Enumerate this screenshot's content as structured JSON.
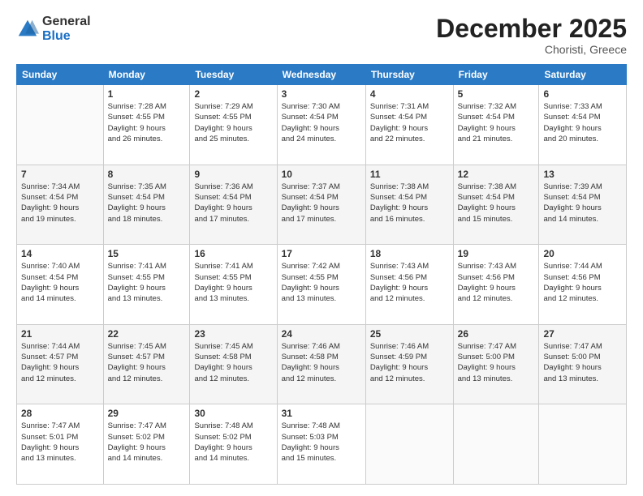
{
  "logo": {
    "general": "General",
    "blue": "Blue"
  },
  "header": {
    "month": "December 2025",
    "location": "Choristi, Greece"
  },
  "days_of_week": [
    "Sunday",
    "Monday",
    "Tuesday",
    "Wednesday",
    "Thursday",
    "Friday",
    "Saturday"
  ],
  "weeks": [
    [
      {
        "day": "",
        "info": ""
      },
      {
        "day": "1",
        "info": "Sunrise: 7:28 AM\nSunset: 4:55 PM\nDaylight: 9 hours\nand 26 minutes."
      },
      {
        "day": "2",
        "info": "Sunrise: 7:29 AM\nSunset: 4:55 PM\nDaylight: 9 hours\nand 25 minutes."
      },
      {
        "day": "3",
        "info": "Sunrise: 7:30 AM\nSunset: 4:54 PM\nDaylight: 9 hours\nand 24 minutes."
      },
      {
        "day": "4",
        "info": "Sunrise: 7:31 AM\nSunset: 4:54 PM\nDaylight: 9 hours\nand 22 minutes."
      },
      {
        "day": "5",
        "info": "Sunrise: 7:32 AM\nSunset: 4:54 PM\nDaylight: 9 hours\nand 21 minutes."
      },
      {
        "day": "6",
        "info": "Sunrise: 7:33 AM\nSunset: 4:54 PM\nDaylight: 9 hours\nand 20 minutes."
      }
    ],
    [
      {
        "day": "7",
        "info": "Sunrise: 7:34 AM\nSunset: 4:54 PM\nDaylight: 9 hours\nand 19 minutes."
      },
      {
        "day": "8",
        "info": "Sunrise: 7:35 AM\nSunset: 4:54 PM\nDaylight: 9 hours\nand 18 minutes."
      },
      {
        "day": "9",
        "info": "Sunrise: 7:36 AM\nSunset: 4:54 PM\nDaylight: 9 hours\nand 17 minutes."
      },
      {
        "day": "10",
        "info": "Sunrise: 7:37 AM\nSunset: 4:54 PM\nDaylight: 9 hours\nand 17 minutes."
      },
      {
        "day": "11",
        "info": "Sunrise: 7:38 AM\nSunset: 4:54 PM\nDaylight: 9 hours\nand 16 minutes."
      },
      {
        "day": "12",
        "info": "Sunrise: 7:38 AM\nSunset: 4:54 PM\nDaylight: 9 hours\nand 15 minutes."
      },
      {
        "day": "13",
        "info": "Sunrise: 7:39 AM\nSunset: 4:54 PM\nDaylight: 9 hours\nand 14 minutes."
      }
    ],
    [
      {
        "day": "14",
        "info": "Sunrise: 7:40 AM\nSunset: 4:54 PM\nDaylight: 9 hours\nand 14 minutes."
      },
      {
        "day": "15",
        "info": "Sunrise: 7:41 AM\nSunset: 4:55 PM\nDaylight: 9 hours\nand 13 minutes."
      },
      {
        "day": "16",
        "info": "Sunrise: 7:41 AM\nSunset: 4:55 PM\nDaylight: 9 hours\nand 13 minutes."
      },
      {
        "day": "17",
        "info": "Sunrise: 7:42 AM\nSunset: 4:55 PM\nDaylight: 9 hours\nand 13 minutes."
      },
      {
        "day": "18",
        "info": "Sunrise: 7:43 AM\nSunset: 4:56 PM\nDaylight: 9 hours\nand 12 minutes."
      },
      {
        "day": "19",
        "info": "Sunrise: 7:43 AM\nSunset: 4:56 PM\nDaylight: 9 hours\nand 12 minutes."
      },
      {
        "day": "20",
        "info": "Sunrise: 7:44 AM\nSunset: 4:56 PM\nDaylight: 9 hours\nand 12 minutes."
      }
    ],
    [
      {
        "day": "21",
        "info": "Sunrise: 7:44 AM\nSunset: 4:57 PM\nDaylight: 9 hours\nand 12 minutes."
      },
      {
        "day": "22",
        "info": "Sunrise: 7:45 AM\nSunset: 4:57 PM\nDaylight: 9 hours\nand 12 minutes."
      },
      {
        "day": "23",
        "info": "Sunrise: 7:45 AM\nSunset: 4:58 PM\nDaylight: 9 hours\nand 12 minutes."
      },
      {
        "day": "24",
        "info": "Sunrise: 7:46 AM\nSunset: 4:58 PM\nDaylight: 9 hours\nand 12 minutes."
      },
      {
        "day": "25",
        "info": "Sunrise: 7:46 AM\nSunset: 4:59 PM\nDaylight: 9 hours\nand 12 minutes."
      },
      {
        "day": "26",
        "info": "Sunrise: 7:47 AM\nSunset: 5:00 PM\nDaylight: 9 hours\nand 13 minutes."
      },
      {
        "day": "27",
        "info": "Sunrise: 7:47 AM\nSunset: 5:00 PM\nDaylight: 9 hours\nand 13 minutes."
      }
    ],
    [
      {
        "day": "28",
        "info": "Sunrise: 7:47 AM\nSunset: 5:01 PM\nDaylight: 9 hours\nand 13 minutes."
      },
      {
        "day": "29",
        "info": "Sunrise: 7:47 AM\nSunset: 5:02 PM\nDaylight: 9 hours\nand 14 minutes."
      },
      {
        "day": "30",
        "info": "Sunrise: 7:48 AM\nSunset: 5:02 PM\nDaylight: 9 hours\nand 14 minutes."
      },
      {
        "day": "31",
        "info": "Sunrise: 7:48 AM\nSunset: 5:03 PM\nDaylight: 9 hours\nand 15 minutes."
      },
      {
        "day": "",
        "info": ""
      },
      {
        "day": "",
        "info": ""
      },
      {
        "day": "",
        "info": ""
      }
    ]
  ]
}
